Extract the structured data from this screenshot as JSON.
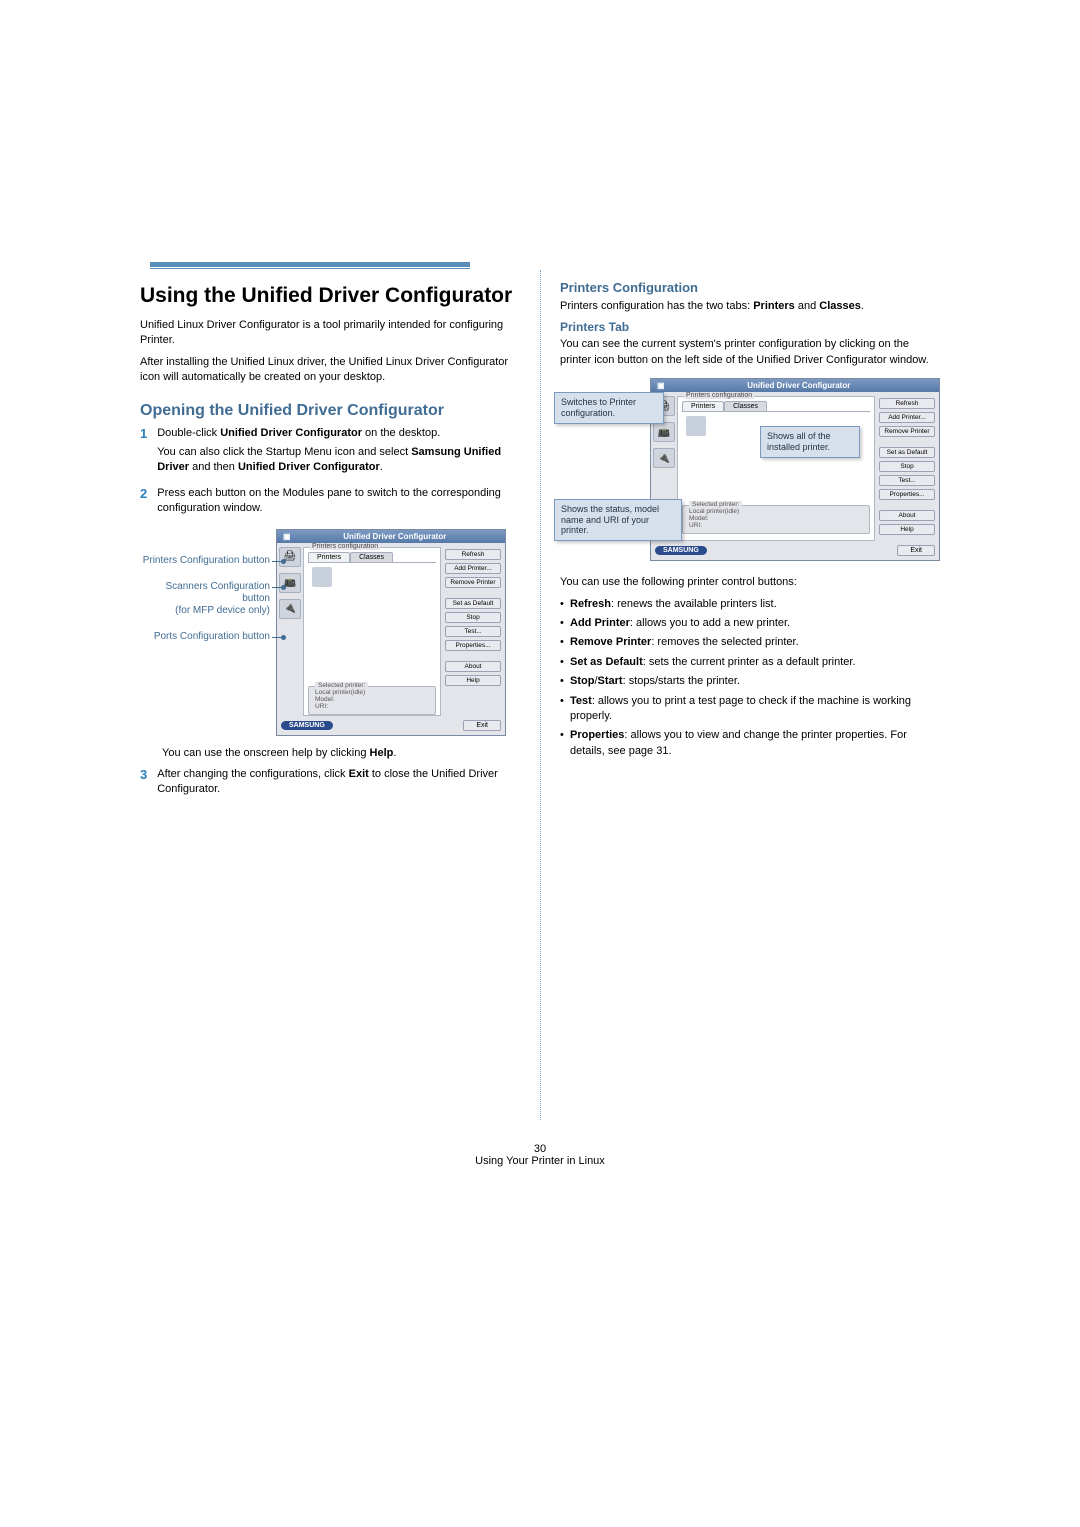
{
  "page": {
    "number": "30",
    "running_footer": "Using Your Printer in Linux"
  },
  "left": {
    "h1": "Using the Unified Driver Configurator",
    "intro1": "Unified Linux Driver Configurator is a tool primarily intended for configuring Printer.",
    "intro2": "After installing the Unified Linux driver, the Unified Linux Driver Configurator icon will automatically be created on your desktop.",
    "h2": "Opening the Unified Driver Configurator",
    "steps": {
      "s1n": "1",
      "s1a_pre": "Double-click ",
      "s1a_bold": "Unified Driver Configurator",
      "s1a_post": " on the desktop.",
      "s1b_pre": "You can also click the Startup Menu icon and select ",
      "s1b_bold1": "Samsung Unified Driver",
      "s1b_mid": " and then ",
      "s1b_bold2": "Unified Driver Configurator",
      "s1b_post": ".",
      "s2n": "2",
      "s2": "Press each button on the Modules pane to switch to the corresponding configuration window.",
      "s3_help_pre": "You can use the onscreen help by clicking ",
      "s3_help_bold": "Help",
      "s3_help_post": ".",
      "s3n": "3",
      "s3_pre": "After changing the configurations, click ",
      "s3_bold": "Exit",
      "s3_post": " to close the Unified Driver Configurator."
    },
    "labels": {
      "printers_btn": "Printers Configuration button",
      "scanners_btn_l1": "Scanners Configuration button",
      "scanners_btn_l2": "(for MFP device only)",
      "ports_btn": "Ports Configuration button"
    }
  },
  "right": {
    "h2": "Printers Configuration",
    "intro_pre": "Printers configuration has the two tabs: ",
    "intro_b1": "Printers",
    "intro_mid": " and ",
    "intro_b2": "Classes",
    "intro_post": ".",
    "h4": "Printers Tab",
    "tab_intro": "You can see the current system's printer configuration by clicking on the printer icon button on the left side of the Unified Driver Configurator window.",
    "callouts": {
      "top": "Switches to Printer configuration.",
      "mid": "Shows all of the installed printer.",
      "bot": "Shows the status, model name and URI of your printer."
    },
    "ctl_intro": "You can use the following printer control buttons:",
    "bullets": {
      "b1_b": "Refresh",
      "b1_t": ": renews the available printers list.",
      "b2_b": "Add Printer",
      "b2_t": ": allows you to add a new printer.",
      "b3_b": "Remove Printer",
      "b3_t": ": removes the selected printer.",
      "b4_b": "Set as Default",
      "b4_t": ": sets the current printer as a default printer.",
      "b5_b1": "Stop",
      "b5_sep": "/",
      "b5_b2": "Start",
      "b5_t": ": stops/starts the printer.",
      "b6_b": "Test",
      "b6_t": ": allows you to print a test page to check if the machine is working properly.",
      "b7_b": "Properties",
      "b7_t": ": allows you to view and change the printer properties. For details, see page 31."
    }
  },
  "shot": {
    "title": "Unified Driver Configurator",
    "panel_label": "Printers configuration",
    "tab_printers": "Printers",
    "tab_classes": "Classes",
    "btn_refresh": "Refresh",
    "btn_add": "Add Printer...",
    "btn_remove": "Remove Printer",
    "btn_default": "Set as Default",
    "btn_stop": "Stop",
    "btn_test": "Test...",
    "btn_props": "Properties...",
    "btn_about": "About",
    "btn_help": "Help",
    "selected_legend": "Selected printer:",
    "sel_local": "Local printer(idle)",
    "sel_model": "Model:",
    "sel_uri": "URI:",
    "brand": "SAMSUNG",
    "exit": "Exit",
    "icon_printer": "🖨",
    "icon_scanner": "📠",
    "icon_port": "🔌"
  }
}
